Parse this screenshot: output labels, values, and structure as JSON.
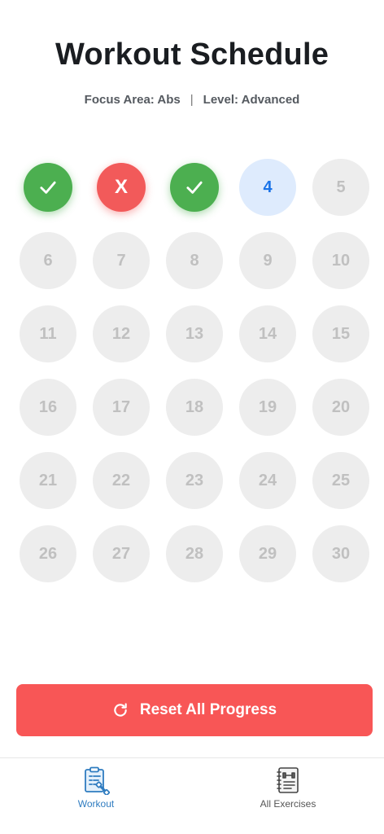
{
  "header": {
    "title": "Workout Schedule",
    "focus_area": "Focus Area: Abs",
    "separator": "|",
    "level": "Level: Advanced"
  },
  "schedule": {
    "days": [
      {
        "day": "1",
        "status": "completed",
        "icon": "check-icon"
      },
      {
        "day": "2",
        "status": "missed",
        "mark": "X"
      },
      {
        "day": "3",
        "status": "completed",
        "icon": "check-icon"
      },
      {
        "day": "4",
        "status": "current"
      },
      {
        "day": "5",
        "status": "locked"
      },
      {
        "day": "6",
        "status": "locked"
      },
      {
        "day": "7",
        "status": "locked"
      },
      {
        "day": "8",
        "status": "locked"
      },
      {
        "day": "9",
        "status": "locked"
      },
      {
        "day": "10",
        "status": "locked"
      },
      {
        "day": "11",
        "status": "locked"
      },
      {
        "day": "12",
        "status": "locked"
      },
      {
        "day": "13",
        "status": "locked"
      },
      {
        "day": "14",
        "status": "locked"
      },
      {
        "day": "15",
        "status": "locked"
      },
      {
        "day": "16",
        "status": "locked"
      },
      {
        "day": "17",
        "status": "locked"
      },
      {
        "day": "18",
        "status": "locked"
      },
      {
        "day": "19",
        "status": "locked"
      },
      {
        "day": "20",
        "status": "locked"
      },
      {
        "day": "21",
        "status": "locked"
      },
      {
        "day": "22",
        "status": "locked"
      },
      {
        "day": "23",
        "status": "locked"
      },
      {
        "day": "24",
        "status": "locked"
      },
      {
        "day": "25",
        "status": "locked"
      },
      {
        "day": "26",
        "status": "locked"
      },
      {
        "day": "27",
        "status": "locked"
      },
      {
        "day": "28",
        "status": "locked"
      },
      {
        "day": "29",
        "status": "locked"
      },
      {
        "day": "30",
        "status": "locked"
      }
    ]
  },
  "actions": {
    "reset_label": "Reset All Progress",
    "reset_icon": "refresh-icon"
  },
  "nav": {
    "workout_label": "Workout",
    "workout_icon": "clipboard-workout-icon",
    "exercises_label": "All Exercises",
    "exercises_icon": "dumbbell-notebook-icon"
  },
  "colors": {
    "completed": "#4caf50",
    "missed": "#f25a5a",
    "current_bg": "#deebfd",
    "current_text": "#1a73e8",
    "locked_bg": "#ededed",
    "reset_button": "#f85656",
    "nav_active": "#2f7cc0"
  }
}
